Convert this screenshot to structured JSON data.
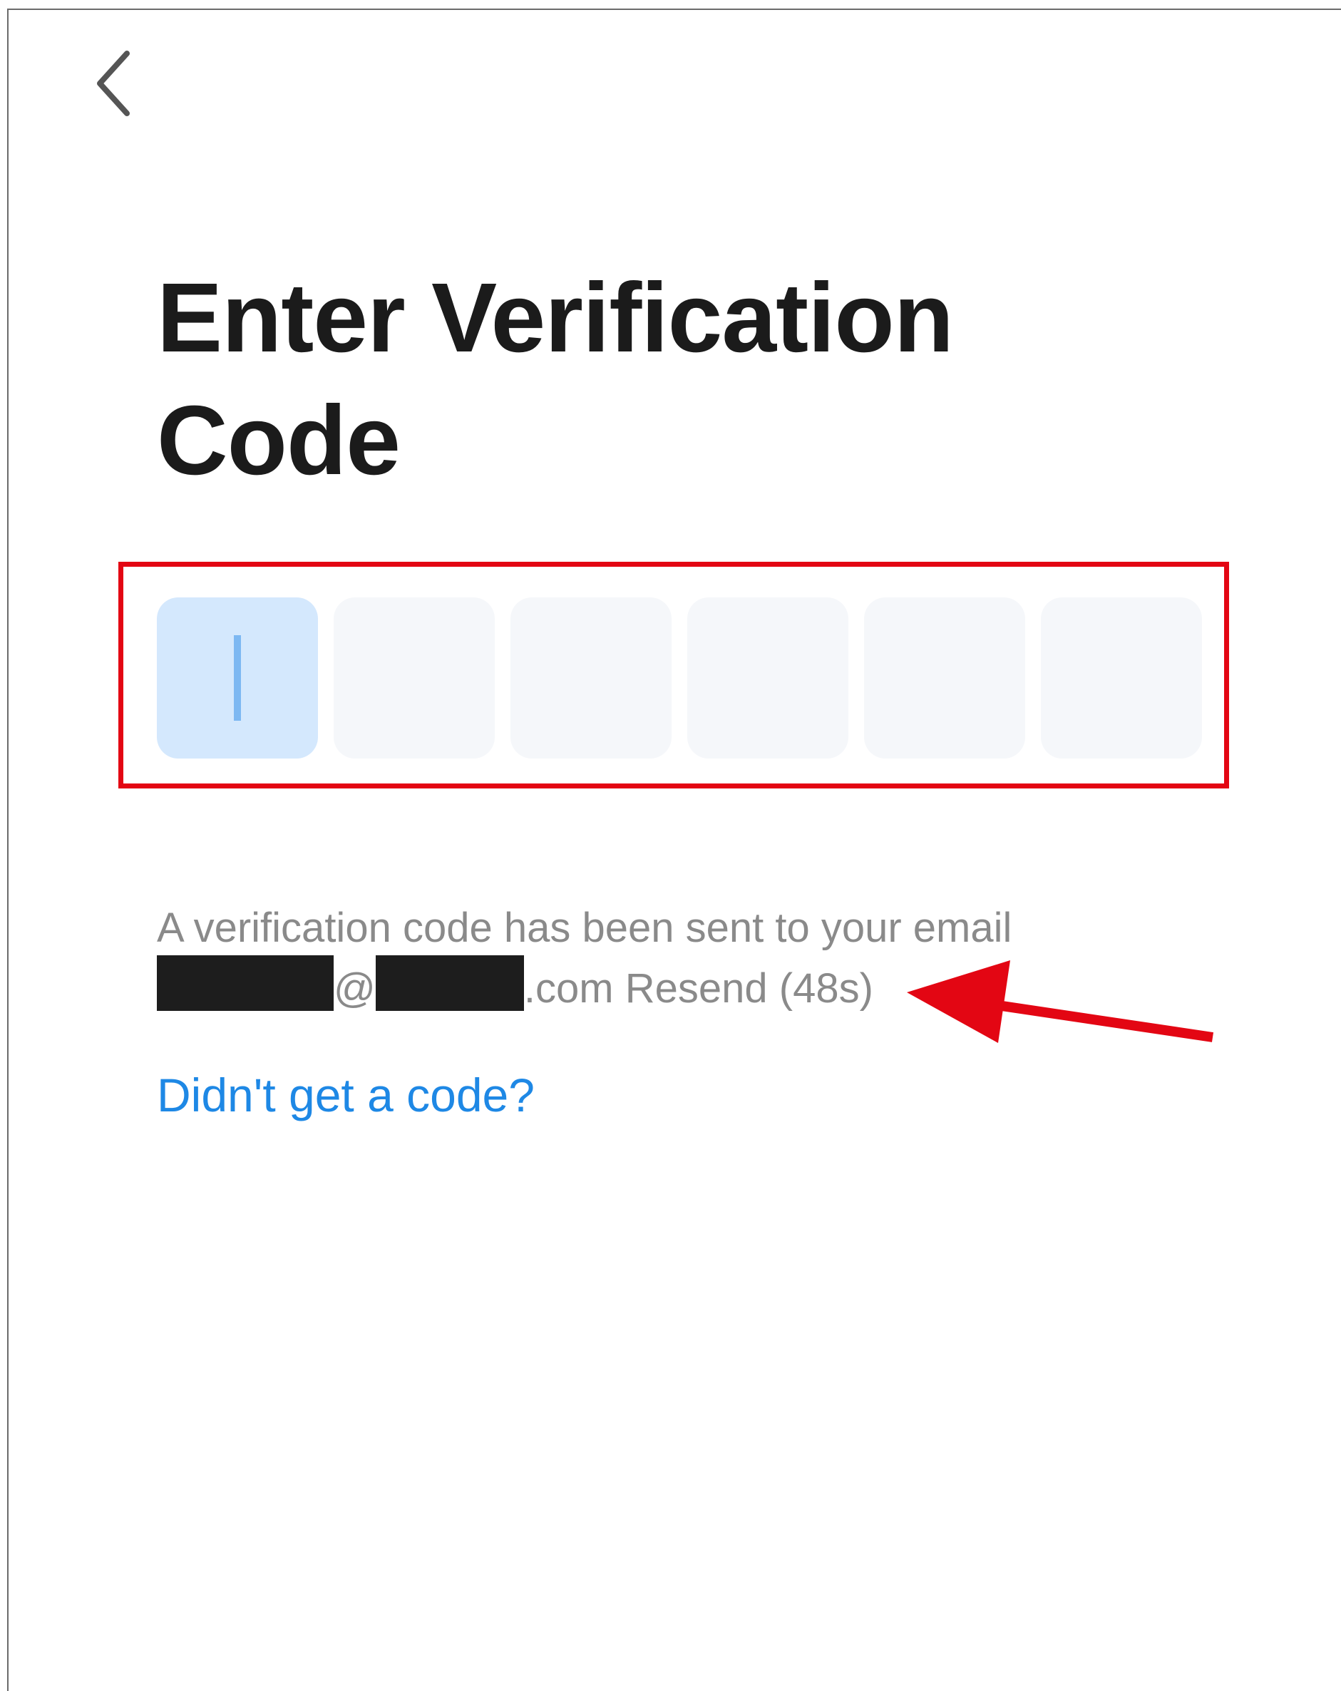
{
  "header": {
    "back_icon": "chevron-left-icon"
  },
  "main": {
    "title": "Enter Verification Code",
    "code_input": {
      "length": 6,
      "values": [
        "",
        "",
        "",
        "",
        "",
        ""
      ],
      "active_index": 0
    },
    "message": {
      "line1": "A verification code has been sent to your email",
      "at_sign": "@",
      "domain_suffix": ".com",
      "resend_label": "Resend",
      "countdown": "(48s)"
    },
    "help_link": "Didn't get a code?"
  },
  "annotation": {
    "frame_color": "#e30613",
    "arrow_color": "#e30613"
  },
  "colors": {
    "title": "#1b1b1b",
    "message": "#8a8a8a",
    "link": "#1e88e5",
    "active_box": "#d4e8fd",
    "inactive_box": "#f5f7fa",
    "caret": "#7db8f2"
  }
}
